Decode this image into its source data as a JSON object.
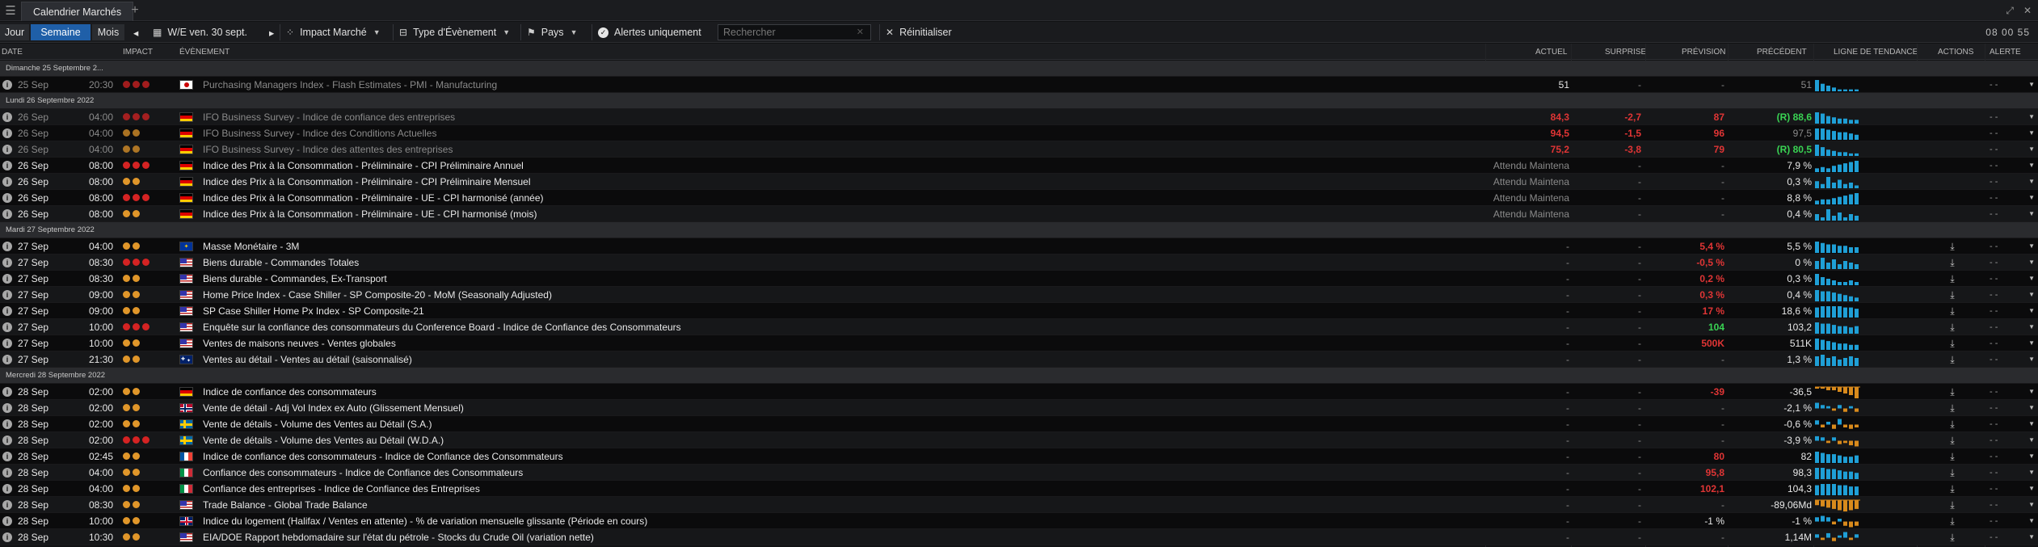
{
  "window": {
    "tab_title": "Calendrier Marchés",
    "plus": "+",
    "menu_icon": "hamburger-icon",
    "win_icons": [
      "⤢",
      "✕"
    ]
  },
  "toolbar": {
    "jour": "Jour",
    "semaine": "Semaine",
    "mois": "Mois",
    "week": "W/E ven. 30 sept.",
    "impact": "Impact Marché",
    "type": "Type d'Évènement",
    "pays": "Pays",
    "alerts": "Alertes uniquement",
    "search_placeholder": "Rechercher",
    "reset": "Réinitialiser",
    "clock": "08 00 55"
  },
  "columns": {
    "date": "DATE",
    "impact": "IMPACT",
    "event": "ÉVÈNEMENT",
    "actuel": "ACTUEL",
    "surprise": "SURPRISE",
    "prevision": "PRÉVISION",
    "precedent": "PRÉCÉDENT",
    "trend": "LIGNE DE TENDANCE",
    "actions": "ACTIONS",
    "alerte": "ALERTE"
  },
  "colors": {
    "high": "#d42323",
    "med": "#e0962a",
    "low": "#b06a1e",
    "bar_teal": "#1f9fd6",
    "bar_orange": "#d88a1c"
  },
  "groups": [
    {
      "label": "Dimanche 25 Septembre 2...",
      "rows": [
        {
          "date": "25 Sep",
          "time": "20:30",
          "impact": 3,
          "faded": true,
          "flag": "jp",
          "event": "Purchasing Managers Index - Flash Estimates - PMI - Manufacturing",
          "actuel": "51",
          "ac": "white",
          "surprise": "-",
          "prevision": "-",
          "pc": "muted",
          "precedent": "51",
          "prc": "muted",
          "trend": [
            6,
            4,
            3,
            2,
            1,
            1,
            1,
            1
          ],
          "tc": "teal",
          "dl": false,
          "alert": "- -"
        }
      ]
    },
    {
      "label": "Lundi 26 Septembre 2022",
      "rows": [
        {
          "date": "26 Sep",
          "time": "04:00",
          "impact": 3,
          "faded": true,
          "flag": "de",
          "event": "IFO Business Survey - Indice de confiance des entreprises",
          "actuel": "84,3",
          "ac": "red",
          "surprise": "-2,7",
          "sc": "red",
          "prevision": "87",
          "pc": "red",
          "precedent": "(R) 88,6",
          "prc": "green",
          "trend": [
            9,
            8,
            6,
            5,
            4,
            4,
            3,
            3
          ],
          "tc": "teal",
          "dl": false,
          "alert": "- -"
        },
        {
          "date": "26 Sep",
          "time": "04:00",
          "impact": 2,
          "faded": true,
          "flag": "de",
          "event": "IFO Business Survey - Indice des Conditions Actuelles",
          "actuel": "94,5",
          "ac": "red",
          "surprise": "-1,5",
          "sc": "red",
          "prevision": "96",
          "pc": "red",
          "precedent": "97,5",
          "prc": "muted",
          "trend": [
            9,
            9,
            8,
            7,
            6,
            6,
            5,
            4
          ],
          "tc": "teal",
          "dl": false,
          "alert": "- -"
        },
        {
          "date": "26 Sep",
          "time": "04:00",
          "impact": 2,
          "faded": true,
          "flag": "de",
          "event": "IFO Business Survey - Indice des attentes des entreprises",
          "actuel": "75,2",
          "ac": "red",
          "surprise": "-3,8",
          "sc": "red",
          "prevision": "79",
          "pc": "red",
          "precedent": "(R) 80,5",
          "prc": "green",
          "trend": [
            9,
            7,
            5,
            4,
            3,
            3,
            2,
            2
          ],
          "tc": "teal",
          "dl": false,
          "alert": "- -"
        },
        {
          "date": "26 Sep",
          "time": "08:00",
          "impact": 3,
          "flag": "de",
          "event": "Indice des Prix à la Consommation - Préliminaire - CPI Préliminaire Annuel",
          "actuel": "Attendu Maintena",
          "ac": "muted",
          "surprise": "-",
          "prevision": "-",
          "pc": "muted",
          "precedent": "7,9 %",
          "prc": "white",
          "trend": [
            3,
            4,
            3,
            5,
            6,
            7,
            8,
            9
          ],
          "tc": "teal",
          "dl": false,
          "alert": "- -"
        },
        {
          "date": "26 Sep",
          "time": "08:00",
          "impact": 2,
          "flag": "de",
          "event": "Indice des Prix à la Consommation - Préliminaire - CPI Préliminaire Mensuel",
          "actuel": "Attendu Maintena",
          "ac": "muted",
          "surprise": "-",
          "prevision": "-",
          "pc": "muted",
          "precedent": "0,3 %",
          "prc": "white",
          "trend": [
            5,
            3,
            8,
            4,
            6,
            3,
            4,
            2
          ],
          "tc": "teal",
          "dl": false,
          "alert": "- -"
        },
        {
          "date": "26 Sep",
          "time": "08:00",
          "impact": 3,
          "flag": "de",
          "event": "Indice des Prix à la Consommation - Préliminaire - UE - CPI harmonisé (année)",
          "actuel": "Attendu Maintena",
          "ac": "muted",
          "surprise": "-",
          "prevision": "-",
          "pc": "muted",
          "precedent": "8,8 %",
          "prc": "white",
          "trend": [
            3,
            4,
            4,
            5,
            6,
            7,
            8,
            9
          ],
          "tc": "teal",
          "dl": false,
          "alert": "- -"
        },
        {
          "date": "26 Sep",
          "time": "08:00",
          "impact": 2,
          "flag": "de",
          "event": "Indice des Prix à la Consommation - Préliminaire - UE - CPI harmonisé (mois)",
          "actuel": "Attendu Maintena",
          "ac": "muted",
          "surprise": "-",
          "prevision": "-",
          "pc": "muted",
          "precedent": "0,4 %",
          "prc": "white",
          "trend": [
            4,
            2,
            7,
            3,
            5,
            2,
            4,
            3
          ],
          "tc": "teal",
          "dl": false,
          "alert": "- -"
        }
      ]
    },
    {
      "label": "Mardi 27 Septembre 2022",
      "rows": [
        {
          "date": "27 Sep",
          "time": "04:00",
          "impact": 2,
          "flag": "eu",
          "event": "Masse Monétaire - 3M",
          "actuel": "-",
          "ac": "muted",
          "surprise": "-",
          "prevision": "5,4 %",
          "pc": "red",
          "precedent": "5,5 %",
          "prc": "white",
          "trend": [
            8,
            7,
            6,
            6,
            5,
            5,
            4,
            4
          ],
          "tc": "teal",
          "dl": true,
          "alert": "- -"
        },
        {
          "date": "27 Sep",
          "time": "08:30",
          "impact": 3,
          "flag": "us",
          "event": "Biens durable - Commandes Totales",
          "actuel": "-",
          "ac": "muted",
          "surprise": "-",
          "prevision": "-0,5 %",
          "pc": "red",
          "precedent": "0 %",
          "prc": "white",
          "trend": [
            5,
            7,
            4,
            6,
            3,
            5,
            4,
            3
          ],
          "tc": "teal",
          "dl": true,
          "alert": "- -"
        },
        {
          "date": "27 Sep",
          "time": "08:30",
          "impact": 2,
          "flag": "us",
          "event": "Biens durable - Commandes, Ex-Transport",
          "actuel": "-",
          "ac": "muted",
          "surprise": "-",
          "prevision": "0,2 %",
          "pc": "red",
          "precedent": "0,3 %",
          "prc": "white",
          "trend": [
            7,
            5,
            4,
            3,
            2,
            2,
            3,
            2
          ],
          "tc": "teal",
          "dl": true,
          "alert": "- -"
        },
        {
          "date": "27 Sep",
          "time": "09:00",
          "impact": 2,
          "flag": "us",
          "event": "Home Price Index - Case Shiller - SP Composite-20 - MoM (Seasonally Adjusted)",
          "actuel": "-",
          "ac": "muted",
          "surprise": "-",
          "prevision": "0,3 %",
          "pc": "red",
          "precedent": "0,4 %",
          "prc": "white",
          "trend": [
            9,
            8,
            8,
            7,
            6,
            5,
            4,
            3
          ],
          "tc": "teal",
          "dl": true,
          "alert": "- -"
        },
        {
          "date": "27 Sep",
          "time": "09:00",
          "impact": 2,
          "flag": "us",
          "event": "SP Case Shiller Home Px Index - SP Composite-21",
          "actuel": "-",
          "ac": "muted",
          "surprise": "-",
          "prevision": "17 %",
          "pc": "red",
          "precedent": "18,6 %",
          "prc": "white",
          "trend": [
            8,
            9,
            9,
            9,
            9,
            8,
            8,
            7
          ],
          "tc": "teal",
          "dl": true,
          "alert": "- -"
        },
        {
          "date": "27 Sep",
          "time": "10:00",
          "impact": 3,
          "flag": "us",
          "event": "Enquête sur la confiance des consommateurs du Conference Board - Indice de Confiance des Consommateurs",
          "actuel": "-",
          "ac": "muted",
          "surprise": "-",
          "prevision": "104",
          "pc": "green",
          "precedent": "103,2",
          "prc": "white",
          "trend": [
            9,
            8,
            8,
            7,
            6,
            6,
            5,
            6
          ],
          "tc": "teal",
          "dl": true,
          "alert": "- -"
        },
        {
          "date": "27 Sep",
          "time": "10:00",
          "impact": 2,
          "flag": "us",
          "event": "Ventes de maisons neuves - Ventes globales",
          "actuel": "-",
          "ac": "muted",
          "surprise": "-",
          "prevision": "500K",
          "pc": "red",
          "precedent": "511K",
          "prc": "white",
          "trend": [
            9,
            8,
            7,
            6,
            5,
            5,
            4,
            4
          ],
          "tc": "teal",
          "dl": true,
          "alert": "- -"
        },
        {
          "date": "27 Sep",
          "time": "21:30",
          "impact": 2,
          "flag": "au",
          "event": "Ventes au détail - Ventes au détail (saisonnalisé)",
          "actuel": "-",
          "ac": "muted",
          "surprise": "-",
          "prevision": "-",
          "pc": "muted",
          "precedent": "1,3 %",
          "prc": "white",
          "trend": [
            6,
            7,
            5,
            6,
            4,
            5,
            6,
            5
          ],
          "tc": "teal",
          "dl": true,
          "alert": "- -"
        }
      ]
    },
    {
      "label": "Mercredi 28 Septembre 2022",
      "rows": [
        {
          "date": "28 Sep",
          "time": "02:00",
          "impact": 2,
          "flag": "de",
          "event": "Indice de confiance des consommateurs",
          "actuel": "-",
          "ac": "muted",
          "surprise": "-",
          "prevision": "-39",
          "pc": "red",
          "precedent": "-36,5",
          "prc": "white",
          "trend": [
            1,
            1,
            2,
            2,
            3,
            4,
            5,
            7
          ],
          "tc": "orange",
          "neg": true,
          "dl": true,
          "alert": "- -"
        },
        {
          "date": "28 Sep",
          "time": "02:00",
          "impact": 2,
          "flag": "no",
          "event": "Vente de détail - Adj Vol Index ex Auto (Glissement Mensuel)",
          "actuel": "-",
          "ac": "muted",
          "surprise": "-",
          "prevision": "-",
          "pc": "muted",
          "precedent": "-2,1 %",
          "prc": "white",
          "trend": [
            5,
            3,
            2,
            -2,
            3,
            -3,
            2,
            -3
          ],
          "tc": "mix",
          "dl": true,
          "alert": "- -"
        },
        {
          "date": "28 Sep",
          "time": "02:00",
          "impact": 2,
          "flag": "se",
          "event": "Vente de détails - Volume des Ventes au Détail (S.A.)",
          "actuel": "-",
          "ac": "muted",
          "surprise": "-",
          "prevision": "-",
          "pc": "muted",
          "precedent": "-0,6 %",
          "prc": "white",
          "trend": [
            3,
            -2,
            2,
            -3,
            4,
            -2,
            -3,
            -2
          ],
          "tc": "mix",
          "dl": true,
          "alert": "- -"
        },
        {
          "date": "28 Sep",
          "time": "02:00",
          "impact": 3,
          "flag": "se",
          "event": "Vente de détails - Volume des Ventes au Détail (W.D.A.)",
          "actuel": "-",
          "ac": "muted",
          "surprise": "-",
          "prevision": "-",
          "pc": "muted",
          "precedent": "-3,9 %",
          "prc": "white",
          "trend": [
            4,
            3,
            -2,
            3,
            -3,
            -2,
            -4,
            -5
          ],
          "tc": "mix",
          "dl": true,
          "alert": "- -"
        },
        {
          "date": "28 Sep",
          "time": "02:45",
          "impact": 2,
          "flag": "fr",
          "event": "Indice de confiance des consommateurs - Indice de Confiance des Consommateurs",
          "actuel": "-",
          "ac": "muted",
          "surprise": "-",
          "prevision": "80",
          "pc": "red",
          "precedent": "82",
          "prc": "white",
          "trend": [
            9,
            8,
            7,
            7,
            6,
            5,
            5,
            6
          ],
          "tc": "teal",
          "dl": true,
          "alert": "- -"
        },
        {
          "date": "28 Sep",
          "time": "04:00",
          "impact": 2,
          "flag": "it",
          "event": "Confiance des consommateurs - Indice de Confiance des Consommateurs",
          "actuel": "-",
          "ac": "muted",
          "surprise": "-",
          "prevision": "95,8",
          "pc": "red",
          "precedent": "98,3",
          "prc": "white",
          "trend": [
            9,
            9,
            8,
            8,
            7,
            6,
            6,
            5
          ],
          "tc": "teal",
          "dl": true,
          "alert": "- -"
        },
        {
          "date": "28 Sep",
          "time": "04:00",
          "impact": 2,
          "flag": "it",
          "event": "Confiance des entreprises - Indice de Confiance des Entreprises",
          "actuel": "-",
          "ac": "muted",
          "surprise": "-",
          "prevision": "102,1",
          "pc": "red",
          "precedent": "104,3",
          "prc": "white",
          "trend": [
            8,
            9,
            9,
            9,
            8,
            8,
            7,
            7
          ],
          "tc": "teal",
          "dl": true,
          "alert": "- -"
        },
        {
          "date": "28 Sep",
          "time": "08:30",
          "impact": 2,
          "flag": "us",
          "event": "Trade Balance - Global Trade Balance",
          "actuel": "-",
          "ac": "muted",
          "surprise": "-",
          "prevision": "-",
          "pc": "muted",
          "precedent": "-89,06Md",
          "prc": "white",
          "trend": [
            4,
            5,
            6,
            7,
            8,
            9,
            8,
            7
          ],
          "tc": "orange",
          "neg": true,
          "dl": true,
          "alert": "- -"
        },
        {
          "date": "28 Sep",
          "time": "10:00",
          "impact": 2,
          "flag": "gb",
          "event": "Indice du logement (Halifax / Ventes en attente) - % de variation mensuelle glissante (Période en cours)",
          "actuel": "-",
          "ac": "muted",
          "surprise": "-",
          "prevision": "-1 %",
          "pc": "white",
          "precedent": "-1 %",
          "prc": "white",
          "trend": [
            3,
            4,
            3,
            -2,
            2,
            -3,
            -4,
            -3
          ],
          "tc": "mix",
          "dl": true,
          "alert": "- -"
        },
        {
          "date": "28 Sep",
          "time": "10:30",
          "impact": 2,
          "flag": "us",
          "event": "EIA/DOE Rapport hebdomadaire sur l'état du pétrole - Stocks du Crude Oil (variation nette)",
          "actuel": "-",
          "ac": "muted",
          "surprise": "-",
          "prevision": "-",
          "pc": "muted",
          "precedent": "1,14M",
          "prc": "white",
          "trend": [
            3,
            -2,
            4,
            -3,
            2,
            5,
            -2,
            3
          ],
          "tc": "mix",
          "dl": true,
          "alert": "- -"
        }
      ]
    }
  ]
}
